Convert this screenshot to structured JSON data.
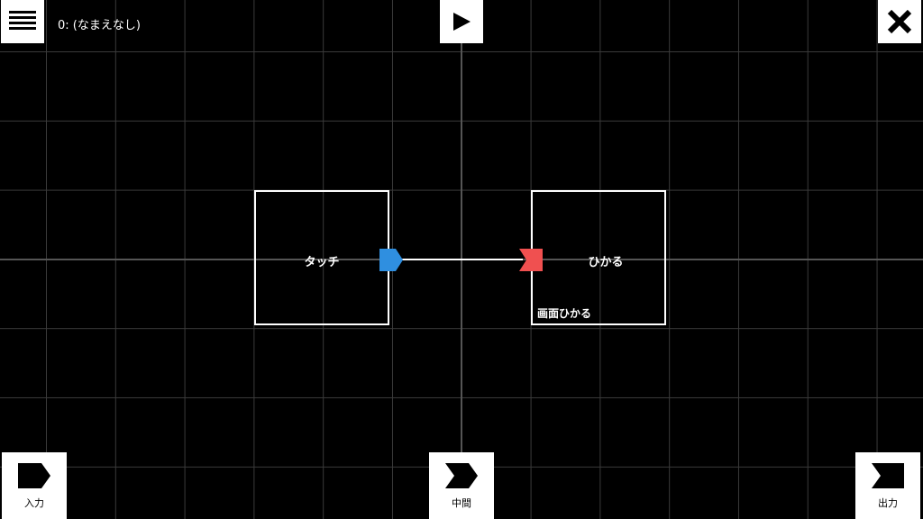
{
  "header": {
    "file_name": "0: (なまえなし)",
    "menu_icon": "hamburger-menu-icon",
    "play_icon": "play-icon",
    "close_icon": "close-icon"
  },
  "nodes": [
    {
      "label": "タッチ",
      "sublabel": "",
      "port": "output",
      "port_color": "#2f8fe0"
    },
    {
      "label": "ひかる",
      "sublabel": "画面ひかる",
      "port": "input",
      "port_color": "#f05050"
    }
  ],
  "palette": {
    "input_label": "入力",
    "middle_label": "中間",
    "output_label": "出力"
  },
  "colors": {
    "background": "#000000",
    "grid": "#3a3a3a",
    "output_port": "#2f8fe0",
    "input_port": "#f05050"
  }
}
